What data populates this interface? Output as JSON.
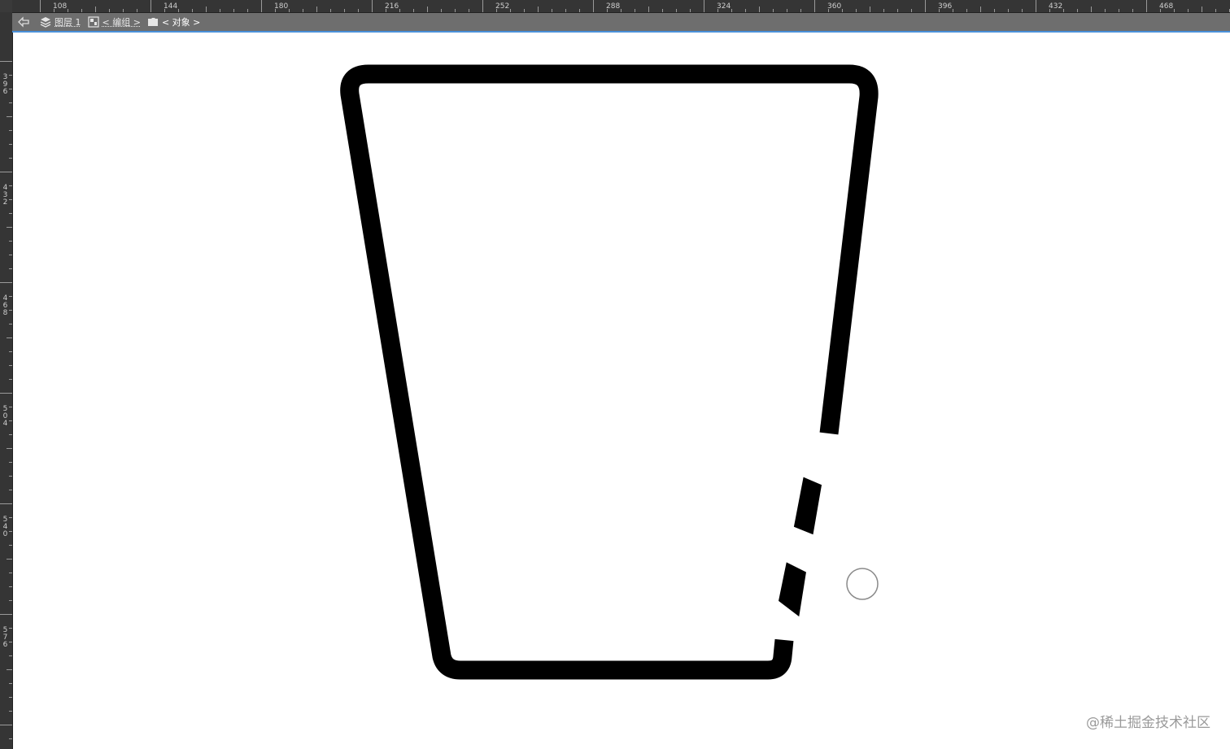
{
  "ruler": {
    "top_labels": [
      "108",
      "144",
      "180",
      "216",
      "252",
      "288",
      "324",
      "360",
      "396",
      "432",
      "468"
    ],
    "left_labels": [
      "396",
      "432",
      "468",
      "504",
      "540",
      "576"
    ]
  },
  "breadcrumb": {
    "back_icon": "back-arrow-icon",
    "layer_label": "图层 1",
    "group_label": "< 编组 >",
    "object_label": "< 对象 >"
  },
  "artwork": {
    "shape": "trapezoid-cup-outline",
    "stroke_color": "#000000",
    "cursor_icon": "circle-cursor-icon"
  },
  "watermark": {
    "text": "@稀土掘金技术社区"
  },
  "colors": {
    "ruler_bg": "#353535",
    "breadcrumb_bg": "#6e6e6e",
    "selection_accent": "#4a90d9",
    "canvas_bg": "#ffffff"
  }
}
